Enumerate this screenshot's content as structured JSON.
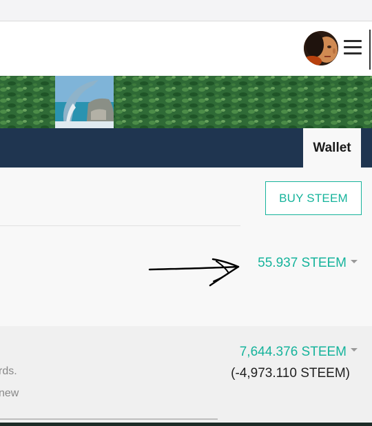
{
  "header": {
    "avatar_alt": "user avatar",
    "menu_icon": "hamburger-menu-icon"
  },
  "nav": {
    "tabs": [
      {
        "label": "Wallet",
        "active": true
      }
    ]
  },
  "wallet": {
    "buy_button": "BUY STEEM",
    "steem_balance": "55.937 STEEM",
    "steem_power": "7,644.376 STEEM",
    "delegated": "(-4,973.110 STEEM)",
    "desc_line1": "rds.",
    "desc_line2": "new"
  },
  "colors": {
    "accent": "#15b39b",
    "navbar": "#1f3550"
  }
}
